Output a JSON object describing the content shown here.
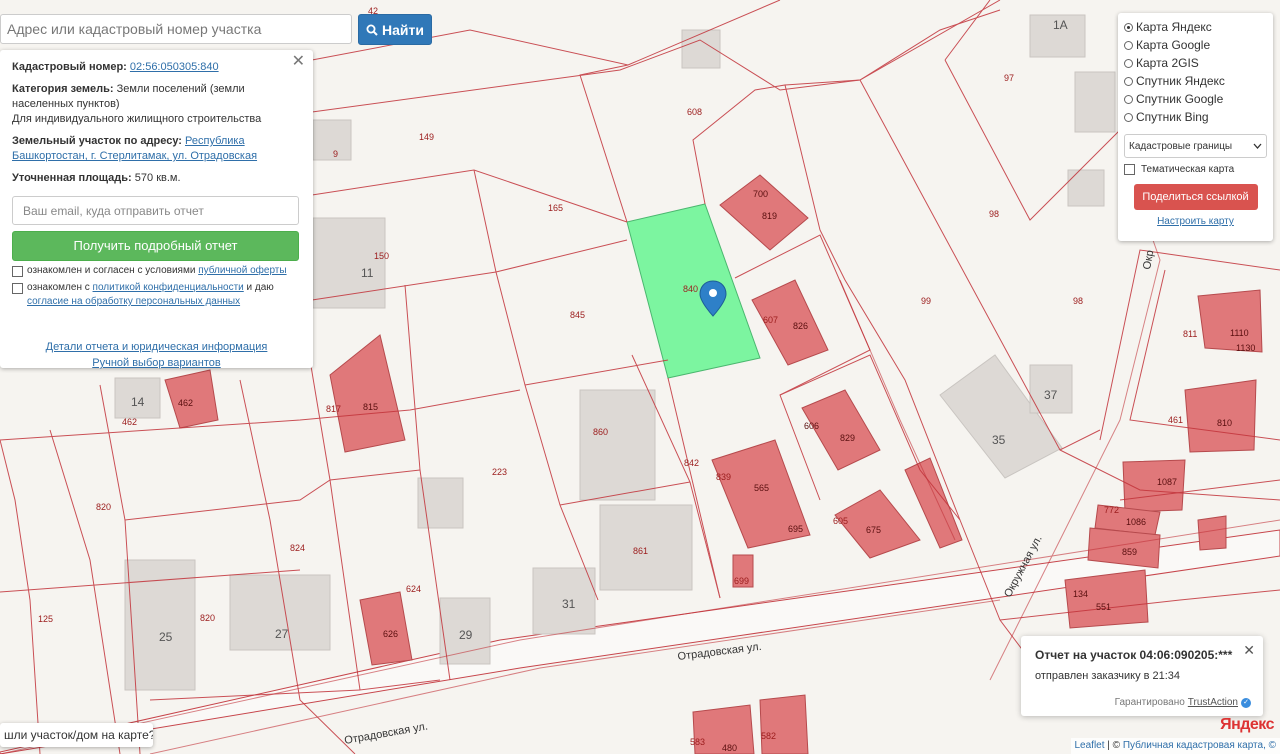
{
  "search": {
    "placeholder": "Адрес или кадастровый номер участка",
    "button_label": "Найти"
  },
  "info": {
    "cadastral_label": "Кадастровый номер:",
    "cadastral_value": "02:56:050305:840",
    "category_label": "Категория земель:",
    "category_value": "Земли поселений (земли населенных пунктов)",
    "use_value": "Для индивидуального жилищного строительства",
    "address_label": "Земельный участок по адресу:",
    "address_value": "Республика Башкортостан, г. Стерлитамак, ул. Отрадовская",
    "area_label": "Уточненная площадь:",
    "area_value": "570 кв.м.",
    "email_placeholder": "Ваш email, куда отправить отчет",
    "report_button": "Получить подробный отчет",
    "consent1_text": "ознакомлен и согласен с условиями ",
    "consent1_link": "публичной оферты",
    "consent2_text": "ознакомлен с ",
    "consent2_link": "политикой конфиденциальности",
    "consent2_tail": " и даю ",
    "consent2_link2": "согласие на обработку персональных данных",
    "details_link": "Детали отчета и юридическая информация",
    "manual_link": "Ручной выбор вариантов"
  },
  "layers": {
    "options": [
      {
        "label": "Карта Яндекс",
        "selected": true
      },
      {
        "label": "Карта Google",
        "selected": false
      },
      {
        "label": "Карта 2GIS",
        "selected": false
      },
      {
        "label": "Спутник Яндекс",
        "selected": false
      },
      {
        "label": "Спутник Google",
        "selected": false
      },
      {
        "label": "Спутник Bing",
        "selected": false
      }
    ],
    "overlay_select": "Кадастровые границы",
    "thematic_label": "Тематическая карта",
    "share_button": "Поделиться ссылкой",
    "configure_link": "Настроить карту"
  },
  "toast": {
    "title": "Отчет на участок 04:06:090205:***",
    "subtitle": "отправлен заказчику в 21:34",
    "guarantee": "Гарантировано",
    "trust_link": "TrustAction"
  },
  "bottom_hint": "шли участок/дом на карте?",
  "attribution": {
    "leaflet": "Leaflet",
    "separator": " | © ",
    "cadastre": "Публичная кадастровая карта, ©"
  },
  "yandex_logo": "Яндекс",
  "map": {
    "selected_color": "#7cf5a0",
    "building_color": "#e0787a",
    "boundary_color": "#c2333a",
    "plot_labels": [
      "42",
      "149",
      "165",
      "608",
      "97",
      "1А",
      "700",
      "819",
      "98",
      "150",
      "11",
      "845",
      "840",
      "607",
      "826",
      "99",
      "98",
      "811",
      "1110",
      "1130",
      "817",
      "815",
      "14",
      "462",
      "462",
      "860",
      "37",
      "606",
      "829",
      "35",
      "461",
      "810",
      "223",
      "842",
      "839",
      "565",
      "695",
      "605",
      "675",
      "1087",
      "772",
      "1086",
      "820",
      "824",
      "861",
      "859",
      "624",
      "134",
      "551",
      "125",
      "25",
      "820",
      "27",
      "29",
      "31",
      "626",
      "699",
      "583",
      "480",
      "582",
      "9"
    ],
    "streets": [
      "Отрадовская ул.",
      "Отрадовская ул.",
      "Окружная ул.",
      "Окр"
    ]
  }
}
